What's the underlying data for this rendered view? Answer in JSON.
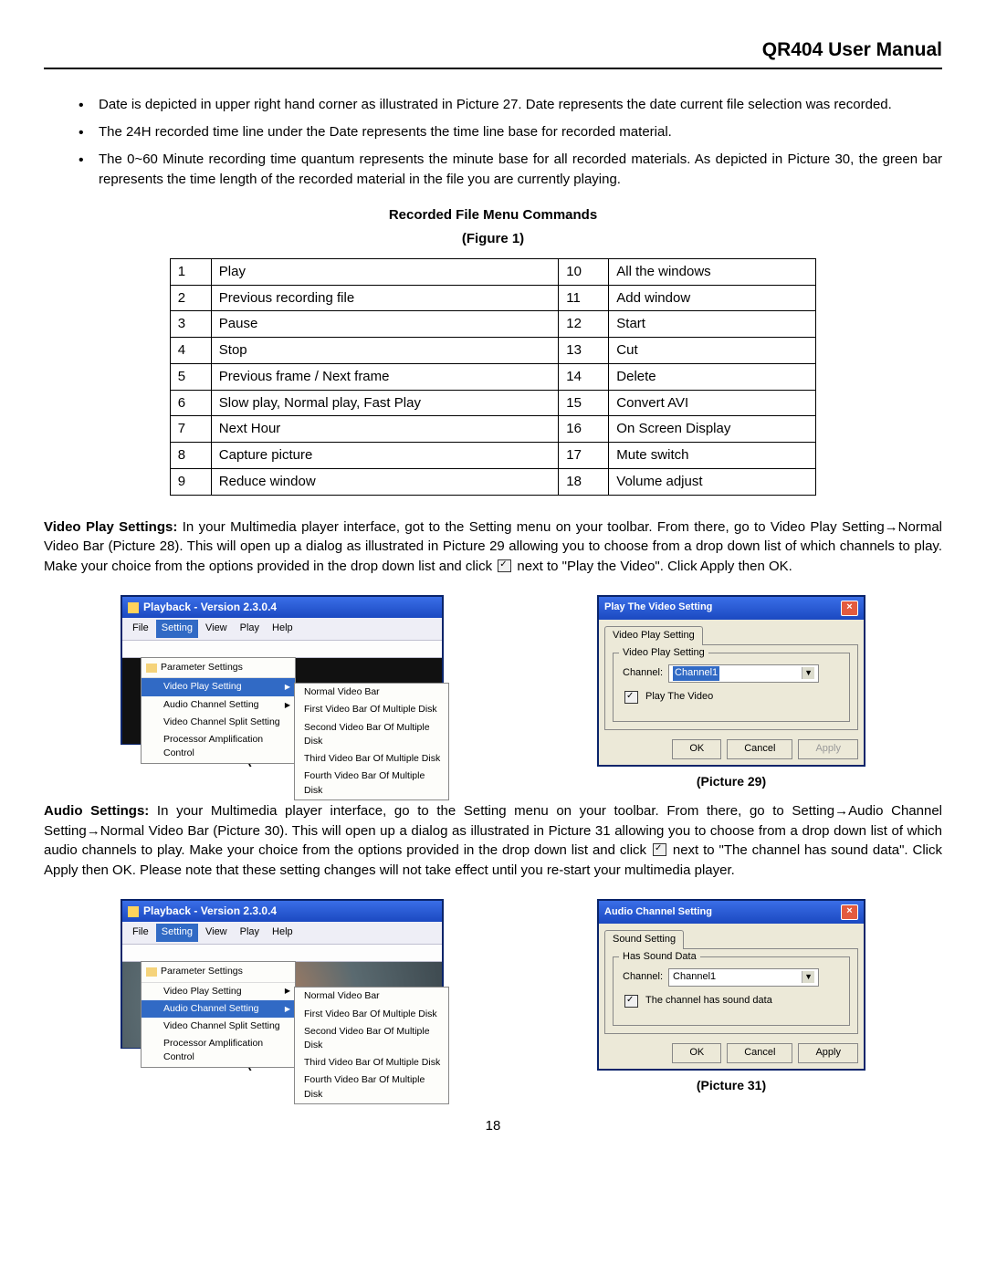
{
  "header": "QR404 User Manual",
  "bullets": [
    "Date is depicted in upper right hand corner as illustrated in Picture 27.   Date represents the date current file selection was recorded.",
    "The 24H recorded time line under the Date represents the time line base for recorded material.",
    "The 0~60 Minute recording time quantum represents the minute base for all recorded materials.   As depicted in Picture 30, the green bar represents the time length of the recorded material in the file you are currently playing."
  ],
  "section_title": "Recorded File Menu Commands",
  "figure_label": "(Figure 1)",
  "table": [
    {
      "n1": "1",
      "c1": "Play",
      "n2": "10",
      "c2": "All the windows"
    },
    {
      "n1": "2",
      "c1": "Previous recording file",
      "n2": "11",
      "c2": "Add window"
    },
    {
      "n1": "3",
      "c1": "Pause",
      "n2": "12",
      "c2": "Start"
    },
    {
      "n1": "4",
      "c1": "Stop",
      "n2": "13",
      "c2": "Cut"
    },
    {
      "n1": "5",
      "c1": "Previous frame / Next frame",
      "n2": "14",
      "c2": "Delete"
    },
    {
      "n1": "6",
      "c1": "Slow play, Normal play, Fast Play",
      "n2": "15",
      "c2": "Convert AVI"
    },
    {
      "n1": "7",
      "c1": "Next Hour",
      "n2": "16",
      "c2": "On Screen Display"
    },
    {
      "n1": "8",
      "c1": "Capture picture",
      "n2": "17",
      "c2": "Mute switch"
    },
    {
      "n1": "9",
      "c1": "Reduce window",
      "n2": "18",
      "c2": "Volume adjust"
    }
  ],
  "para1_lead": "Video Play Settings:",
  "para1_body": " In your Multimedia player interface, got to the Setting menu on your toolbar.   From there, go to Video Play Setting→Normal Video Bar (Picture 28).   This will open up a dialog as illustrated in Picture 29 allowing you to choose from a drop down list of which channels to play.   Make your choice from the options provided in the drop down list and click ",
  "para1_tail": " next to \"Play the Video\". Click Apply then OK.",
  "para2_lead": "Audio Settings:",
  "para2_body": " In your Multimedia player interface, go to the Setting menu on your toolbar.   From there, go to Setting→Audio Channel Setting→Normal Video Bar (Picture 30).   This will open up a dialog as illustrated in Picture 31 allowing you to choose from a drop down list of which audio channels to play.   Make your choice from the options provided in the drop down list and click ",
  "para2_tail": " next to \"The channel has sound data\".   Click Apply then OK.   Please note that these setting changes will not take effect until you re-start your multimedia player.",
  "playback": {
    "title": "Playback - Version 2.3.0.4",
    "menubar": [
      "File",
      "Setting",
      "View",
      "Play",
      "Help"
    ],
    "menu_hi": "Setting",
    "dd_head": "Parameter Settings",
    "dd_items_28": [
      {
        "label": "Video Play Setting",
        "hi": true,
        "arrow": true
      },
      {
        "label": "Audio Channel Setting",
        "hi": false,
        "arrow": true
      },
      {
        "label": "Video Channel Split Setting",
        "hi": false,
        "arrow": false
      },
      {
        "label": "Processor Amplification Control",
        "hi": false,
        "arrow": false
      }
    ],
    "dd_items_30": [
      {
        "label": "Video Play Setting",
        "hi": false,
        "arrow": true
      },
      {
        "label": "Audio Channel Setting",
        "hi": true,
        "arrow": true
      },
      {
        "label": "Video Channel Split Setting",
        "hi": false,
        "arrow": false
      },
      {
        "label": "Processor Amplification Control",
        "hi": false,
        "arrow": false
      }
    ],
    "submenu": [
      "Normal Video Bar",
      "First Video Bar Of Multiple Disk",
      "Second Video Bar Of Multiple Disk",
      "Third Video Bar Of Multiple Disk",
      "Fourth Video Bar Of Multiple Disk"
    ]
  },
  "dlg29": {
    "title": "Play The Video Setting",
    "tab": "Video Play Setting",
    "group": "Video Play Setting",
    "channel_label": "Channel:",
    "channel_value": "Channel1",
    "checkbox": "Play The Video",
    "ok": "OK",
    "cancel": "Cancel",
    "apply": "Apply"
  },
  "dlg31": {
    "title": "Audio Channel Setting",
    "tab": "Sound Setting",
    "group": "Has Sound Data",
    "channel_label": "Channel:",
    "channel_value": "Channel1",
    "checkbox": "The channel has sound data",
    "ok": "OK",
    "cancel": "Cancel",
    "apply": "Apply"
  },
  "captions": {
    "p28": "(Picture 28)",
    "p29": "(Picture 29)",
    "p30": "(Picture 30)",
    "p31": "(Picture 31)"
  },
  "page_number": "18"
}
